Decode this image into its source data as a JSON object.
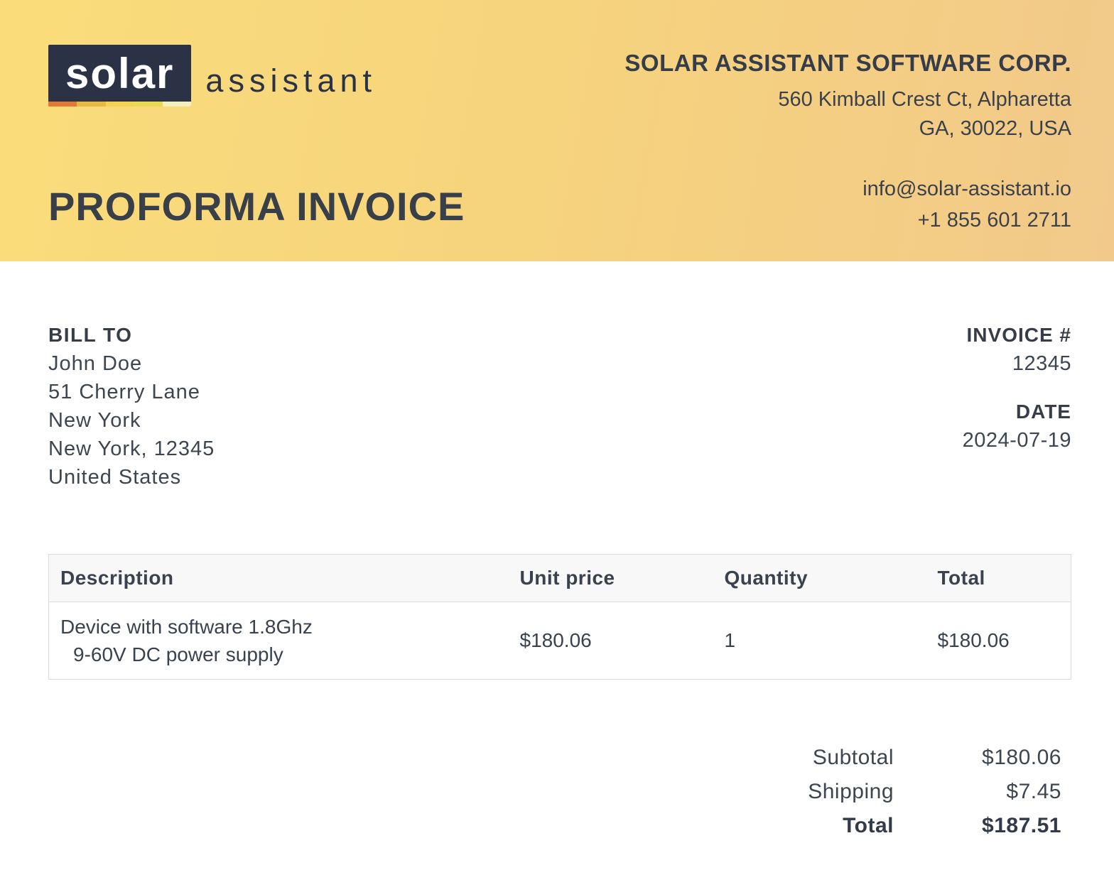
{
  "header": {
    "logo": {
      "primary": "solar",
      "secondary": "assistant",
      "stripe_colors": [
        "#e07a36",
        "#e9b83f",
        "#f4d44e",
        "#e9da52",
        "#f5efbe"
      ]
    },
    "company": {
      "name": "SOLAR ASSISTANT SOFTWARE CORP.",
      "address_line1": "560 Kimball Crest Ct, Alpharetta",
      "address_line2": "GA, 30022, USA",
      "email": "info@solar-assistant.io",
      "phone": "+1 855 601 2711"
    },
    "document_title": "PROFORMA INVOICE"
  },
  "bill_to": {
    "label": "BILL TO",
    "lines": [
      "John Doe",
      "51 Cherry Lane",
      "New York",
      "New York, 12345",
      "United States"
    ]
  },
  "invoice_meta": {
    "invoice_label": "INVOICE #",
    "invoice_number": "12345",
    "date_label": "DATE",
    "date_value": "2024-07-19"
  },
  "items_table": {
    "headers": [
      "Description",
      "Unit price",
      "Quantity",
      "Total"
    ],
    "rows": [
      {
        "description_line1": "Device with software 1.8Ghz",
        "description_line2": "9-60V DC power supply",
        "unit_price": "$180.06",
        "quantity": "1",
        "total": "$180.06"
      }
    ]
  },
  "totals": {
    "rows": [
      {
        "label": "Subtotal",
        "value": "$180.06",
        "bold": false
      },
      {
        "label": "Shipping",
        "value": "$7.45",
        "bold": false
      },
      {
        "label": "Total",
        "value": "$187.51",
        "bold": true
      }
    ]
  },
  "colors": {
    "header_gradient_start": "#fadd7b",
    "header_gradient_end": "#f2c98a",
    "navy": "#2b3246",
    "text": "#3d4650"
  }
}
